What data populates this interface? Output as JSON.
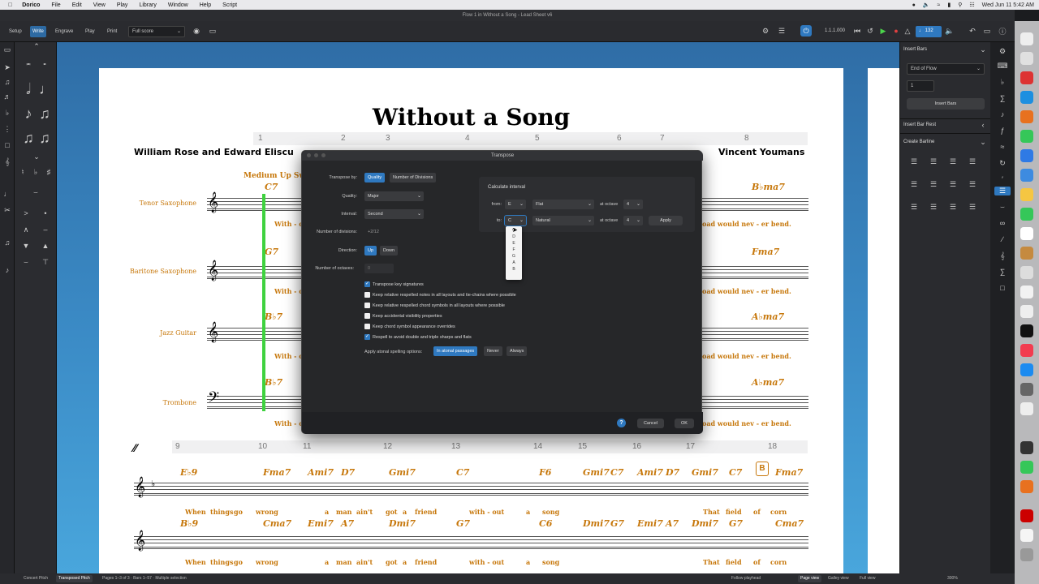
{
  "menubar": {
    "app": "Dorico",
    "items": [
      "File",
      "Edit",
      "View",
      "Play",
      "Library",
      "Window",
      "Help",
      "Script"
    ],
    "clock": "Wed Jun 11  5:42 AM"
  },
  "window": {
    "title": "Flow 1 in Without a Song - Lead Sheet v6"
  },
  "toolbar": {
    "modes": [
      "Setup",
      "Write",
      "Engrave",
      "Play",
      "Print"
    ],
    "active_mode": "Write",
    "layout_select": "Full score",
    "timecode": "1.1.1.000",
    "tempo": "132"
  },
  "score": {
    "title": "Without a Song",
    "lyricists": "William Rose and Edward Eliscu",
    "composer": "Vincent Youmans",
    "style": "Medium Up Swing",
    "bar_numbers_top": [
      "1",
      "2",
      "3",
      "4",
      "5",
      "6",
      "7",
      "8"
    ],
    "bar_numbers_bottom": [
      "9",
      "10",
      "11",
      "12",
      "13",
      "14",
      "15",
      "16",
      "17",
      "18"
    ],
    "instruments": [
      "Tenor Saxophone",
      "Baritone Saxophone",
      "Jazz Guitar",
      "Trombone"
    ],
    "chords_sys1": [
      "C7",
      "G7",
      "B♭7",
      "B♭7"
    ],
    "chords_sys1_right": [
      "B♭ma7",
      "Fma7",
      "A♭ma7",
      "A♭ma7"
    ],
    "lyrics_sys1_left": "With - o",
    "lyrics_sys1_right": "oad would  nev - er  bend.",
    "chords_sys2": [
      "E♭9",
      "Fma7",
      "Ami7",
      "D7",
      "Gmi7",
      "C7",
      "F6",
      "Gmi7",
      "C7",
      "Ami7",
      "D7",
      "Gmi7",
      "C7",
      "Fma7"
    ],
    "chords_sys3": [
      "B♭9",
      "Cma7",
      "Emi7",
      "A7",
      "Dmi7",
      "G7",
      "C6",
      "Dmi7",
      "G7",
      "Emi7",
      "A7",
      "Dmi7",
      "G7",
      "Cma7"
    ],
    "rehearsal_mark": "B",
    "lyrics_sys2": [
      "When",
      "things",
      "go",
      "wrong",
      "a",
      "man",
      "ain't",
      "got",
      "a",
      "friend",
      "with - out",
      "a",
      "song",
      "That",
      "field",
      "of",
      "corn"
    ]
  },
  "dialog": {
    "title": "Transpose",
    "transpose_by_label": "Transpose by:",
    "transpose_by_options": [
      "Quality",
      "Number of Divisions"
    ],
    "transpose_by_selected": "Quality",
    "quality_label": "Quality:",
    "quality_value": "Major",
    "interval_label": "Interval:",
    "interval_value": "Second",
    "divisions_label": "Number of divisions:",
    "divisions_value": "+2/12",
    "direction_label": "Direction:",
    "direction_options": [
      "Up",
      "Down"
    ],
    "direction_selected": "Up",
    "octaves_label": "Number of octaves:",
    "octaves_value": "0",
    "calc_title": "Calculate interval",
    "from_label": "from:",
    "from_note": "E",
    "from_accidental": "Flat",
    "to_label": "to:",
    "to_note": "C",
    "to_accidental": "Natural",
    "at_octave_label": "at octave",
    "from_octave": "4",
    "to_octave": "4",
    "apply_label": "Apply",
    "note_options": [
      "C",
      "D",
      "E",
      "F",
      "G",
      "A",
      "B"
    ],
    "checkboxes": [
      {
        "label": "Transpose key signatures",
        "checked": true
      },
      {
        "label": "Keep relative respelled notes in all layouts and tie-chains where possible",
        "checked": false
      },
      {
        "label": "Keep relative respelled chord symbols in all layouts where possible",
        "checked": false
      },
      {
        "label": "Keep accidental visibility properties",
        "checked": false
      },
      {
        "label": "Keep chord symbol appearance overrides",
        "checked": false
      },
      {
        "label": "Respell to avoid double and triple sharps and flats",
        "checked": true
      }
    ],
    "atonal_label": "Apply atonal spelling options:",
    "atonal_options": [
      "In atonal passages",
      "Never",
      "Always"
    ],
    "atonal_selected": "In atonal passages",
    "help_label": "?",
    "cancel_label": "Cancel",
    "ok_label": "OK"
  },
  "right_panel": {
    "insert_bars_title": "Insert Bars",
    "insert_position": "End of Flow",
    "bar_count": "1",
    "insert_button": "Insert Bars",
    "insert_bar_rest_title": "Insert Bar Rest",
    "create_barline_title": "Create Barline"
  },
  "statusbar": {
    "concert_pitch": "Concert Pitch",
    "transposed_pitch": "Transposed Pitch",
    "info": "Pages 1–3 of 3 · Bars 1–57 · Multiple selection",
    "follow_playhead": "Follow playhead",
    "page_view": "Page view",
    "galley_view": "Galley view",
    "full_view": "Full view",
    "zoom": "300%"
  },
  "colors": {
    "accent": "#2f79c0",
    "score_orange": "#c7780c",
    "selection_green": "#3fd23f"
  }
}
